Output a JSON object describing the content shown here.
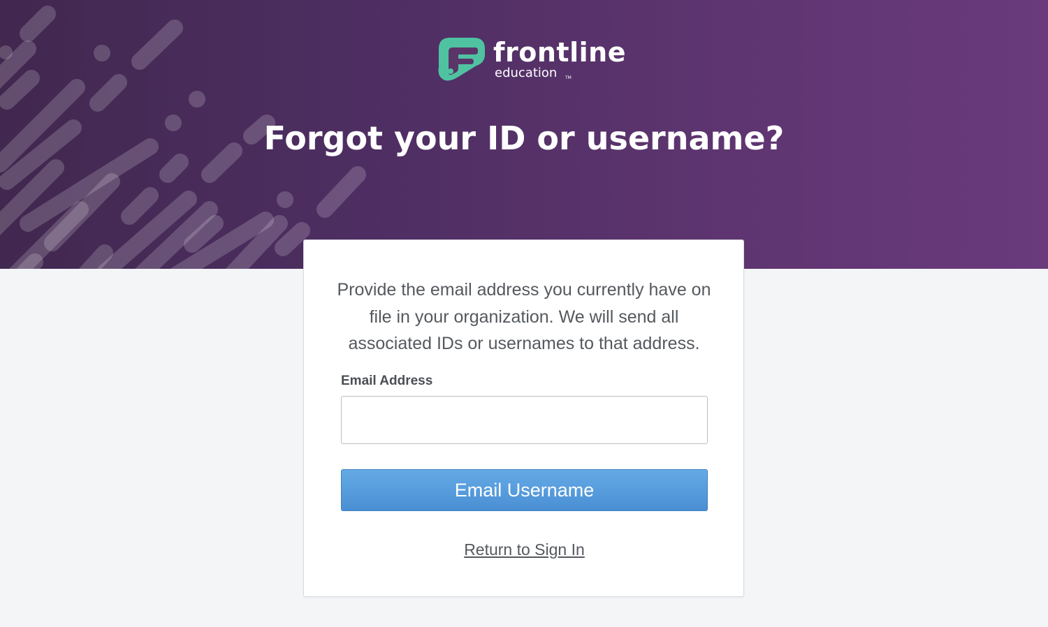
{
  "brand": {
    "name": "frontline",
    "sub": "education",
    "tm": "TM",
    "mark_color": "#4fc3a1"
  },
  "header": {
    "title": "Forgot your ID or username?",
    "background_color": "#4e2e62"
  },
  "form": {
    "instructions": "Provide the email address you currently have on file in your organization.  We will send all associated IDs or usernames to that address.",
    "email_label": "Email Address",
    "email_value": "",
    "email_placeholder": "",
    "submit_label": "Email Username",
    "submit_color": "#5a9edd",
    "return_link": "Return to Sign In"
  }
}
